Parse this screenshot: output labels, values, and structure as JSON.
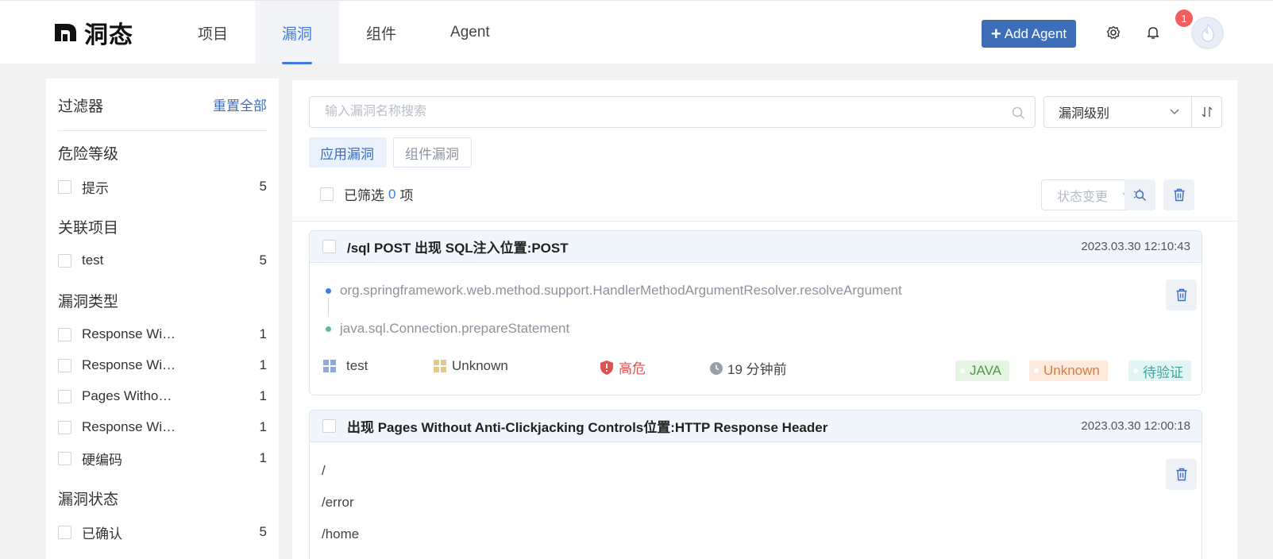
{
  "header": {
    "logo_text": "洞态",
    "nav": [
      "项目",
      "漏洞",
      "组件",
      "Agent"
    ],
    "add_agent": "Add Agent",
    "notification_count": "1"
  },
  "sidebar": {
    "title": "过滤器",
    "reset": "重置全部",
    "sections": {
      "level": {
        "title": "危险等级",
        "items": [
          {
            "label": "提示",
            "count": "5"
          }
        ]
      },
      "project": {
        "title": "关联项目",
        "items": [
          {
            "label": "test",
            "count": "5"
          }
        ]
      },
      "type": {
        "title": "漏洞类型",
        "items": [
          {
            "label": "Response Wi…",
            "count": "1"
          },
          {
            "label": "Response Wi…",
            "count": "1"
          },
          {
            "label": "Pages Witho…",
            "count": "1"
          },
          {
            "label": "Response Wi…",
            "count": "1"
          },
          {
            "label": "硬编码",
            "count": "1"
          }
        ]
      },
      "status": {
        "title": "漏洞状态",
        "items": [
          {
            "label": "已确认",
            "count": "5"
          }
        ]
      }
    }
  },
  "main": {
    "search_placeholder": "输入漏洞名称搜索",
    "level_select": "漏洞级别",
    "tabs": [
      "应用漏洞",
      "组件漏洞"
    ],
    "selected_prefix": "已筛选",
    "selected_count": "0",
    "selected_suffix": "项",
    "status_change": "状态变更",
    "cards": [
      {
        "title": "/sql POST 出现 SQL注入位置:POST",
        "time": "2023.03.30 12:10:43",
        "trace": [
          "org.springframework.web.method.support.HandlerMethodArgumentResolver.resolveArgument",
          "java.sql.Connection.prepareStatement"
        ],
        "project": "test",
        "component": "Unknown",
        "level": "高危",
        "ago": "19 分钟前",
        "tags": [
          "JAVA",
          "Unknown",
          "待验证"
        ]
      },
      {
        "title": "出现 Pages Without Anti-Clickjacking Controls位置:HTTP Response Header",
        "time": "2023.03.30 12:00:18",
        "paths": [
          "/",
          "/error",
          "/home"
        ]
      }
    ]
  },
  "colors": {
    "accent": "#3f7be0",
    "button": "#3f6eb8",
    "danger": "#e05252"
  }
}
